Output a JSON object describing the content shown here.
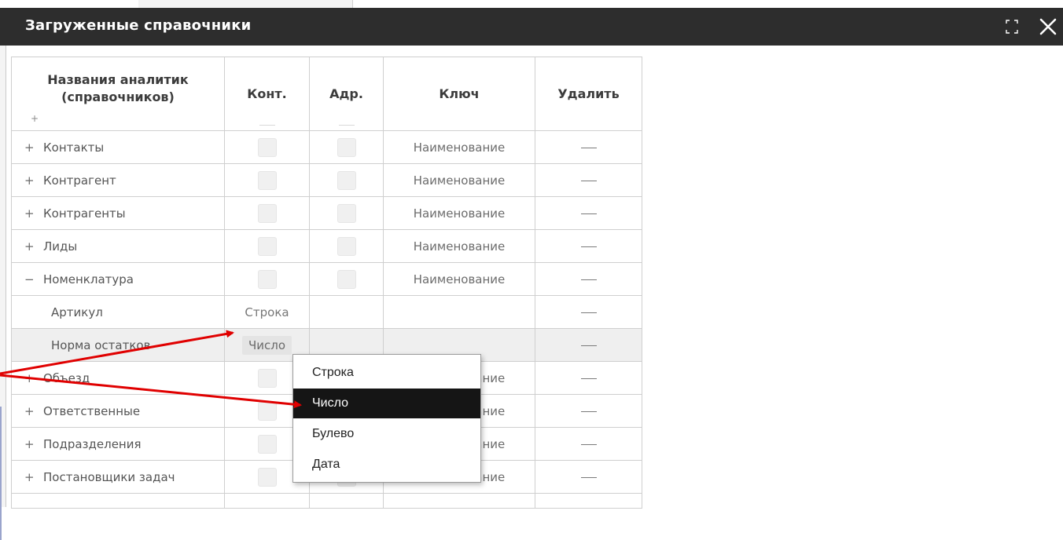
{
  "window": {
    "title": "Загруженные справочники",
    "maximize_icon": "maximize-icon",
    "close_icon": "close-icon",
    "titlebar_color": "#2d2d2d"
  },
  "table": {
    "headers": {
      "name_line1": "Названия аналитик",
      "name_line2": "(справочников)",
      "name_add": "+",
      "cont": "Конт.",
      "adr": "Адр.",
      "key": "Ключ",
      "delete": "Удалить"
    },
    "rows": [
      {
        "toggle": "+",
        "name": "Контакты",
        "key": "Наименование"
      },
      {
        "toggle": "+",
        "name": "Контрагент",
        "key": "Наименование"
      },
      {
        "toggle": "+",
        "name": "Контрагенты",
        "key": "Наименование"
      },
      {
        "toggle": "+",
        "name": "Лиды",
        "key": "Наименование"
      },
      {
        "toggle": "−",
        "name": "Номенклатура",
        "key": "Наименование"
      },
      {
        "name": "Артикул",
        "type": "Строка"
      },
      {
        "name": "Норма остатков",
        "type": "Число"
      },
      {
        "toggle": "+",
        "name": "Объезд",
        "key": "Наименование"
      },
      {
        "toggle": "+",
        "name": "Ответственные",
        "key": "Наименование"
      },
      {
        "toggle": "+",
        "name": "Подразделения",
        "key": "Наименование"
      },
      {
        "toggle": "+",
        "name": "Постановщики задач",
        "key": "Наименование"
      }
    ]
  },
  "dropdown": {
    "options": [
      "Строка",
      "Число",
      "Булево",
      "Дата"
    ],
    "highlighted": "Число"
  },
  "annotation": {
    "arrow_color": "#e00000"
  }
}
